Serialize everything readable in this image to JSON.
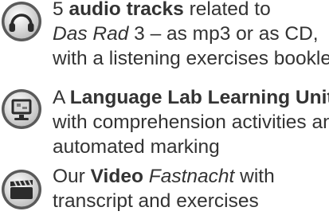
{
  "items": [
    {
      "icon": "headphones-icon",
      "lines": [
        {
          "pre": "5 ",
          "bold": "audio tracks",
          "post": " related to"
        },
        {
          "ital": "Das Rad",
          "post": " 3 – as mp3 or as CD,"
        },
        {
          "text": "with a listening exercises booklet"
        }
      ]
    },
    {
      "icon": "computer-monitor-icon",
      "lines": [
        {
          "pre": "A ",
          "bold": "Language Lab Learning Unit"
        },
        {
          "text": "with comprehension activities and"
        },
        {
          "text": "automated marking"
        }
      ]
    },
    {
      "icon": "clapperboard-icon",
      "lines": [
        {
          "pre": "Our ",
          "bold": "Video",
          "ital": "Fastnacht",
          "post": " with"
        },
        {
          "text": "transcript and exercises"
        }
      ]
    }
  ],
  "colors": {
    "text": "#333333",
    "icon_ring": "#4a4a4a",
    "icon_fill": "#d9d9d9",
    "icon_dark": "#2b2b2b"
  }
}
